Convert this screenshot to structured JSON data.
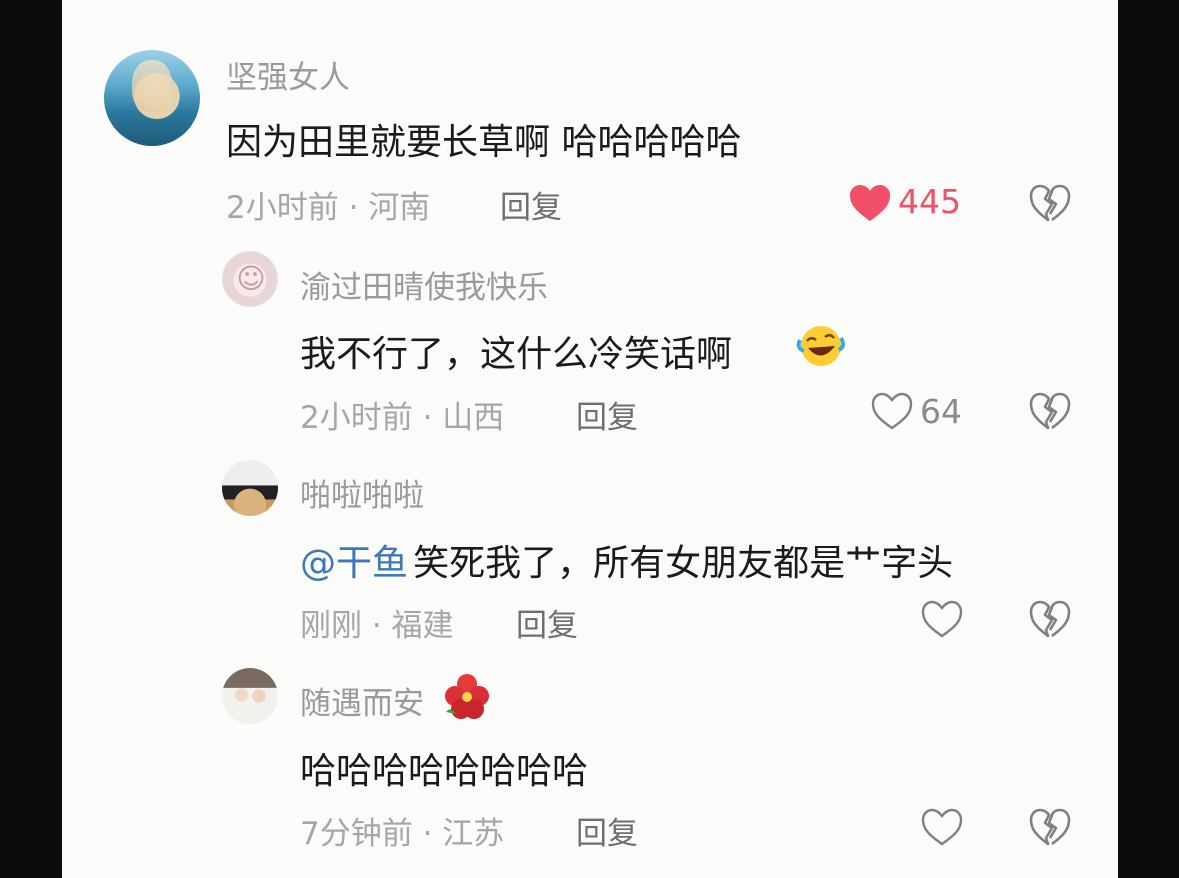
{
  "comments": [
    {
      "username": "坚强女人",
      "text": "因为田里就要长草啊 哈哈哈哈哈",
      "meta": "2小时前 · 河南",
      "reply_label": "回复",
      "like_count": "445",
      "liked": true
    },
    {
      "username": "渝过田晴使我快乐",
      "text": "我不行了，这什么冷笑话啊",
      "meta": "2小时前 · 山西",
      "reply_label": "回复",
      "like_count": "64",
      "liked": false
    },
    {
      "username": "啪啦啪啦",
      "mention": "@干鱼",
      "text": "笑死我了，所有女朋友都是艹字头",
      "meta": "刚刚 · 福建",
      "reply_label": "回复",
      "like_count": "",
      "liked": false
    },
    {
      "username": "随遇而安",
      "text": "哈哈哈哈哈哈哈哈",
      "meta": "7分钟前 · 江苏",
      "reply_label": "回复",
      "like_count": "",
      "liked": false
    }
  ],
  "icons": {
    "like_active_color": "#f24f6b",
    "icon_gray": "#808080",
    "mention_color": "#3f78b8",
    "emoji_laugh": "rolling-on-floor-laughing-emoji",
    "emoji_flower": "hibiscus-emoji"
  }
}
